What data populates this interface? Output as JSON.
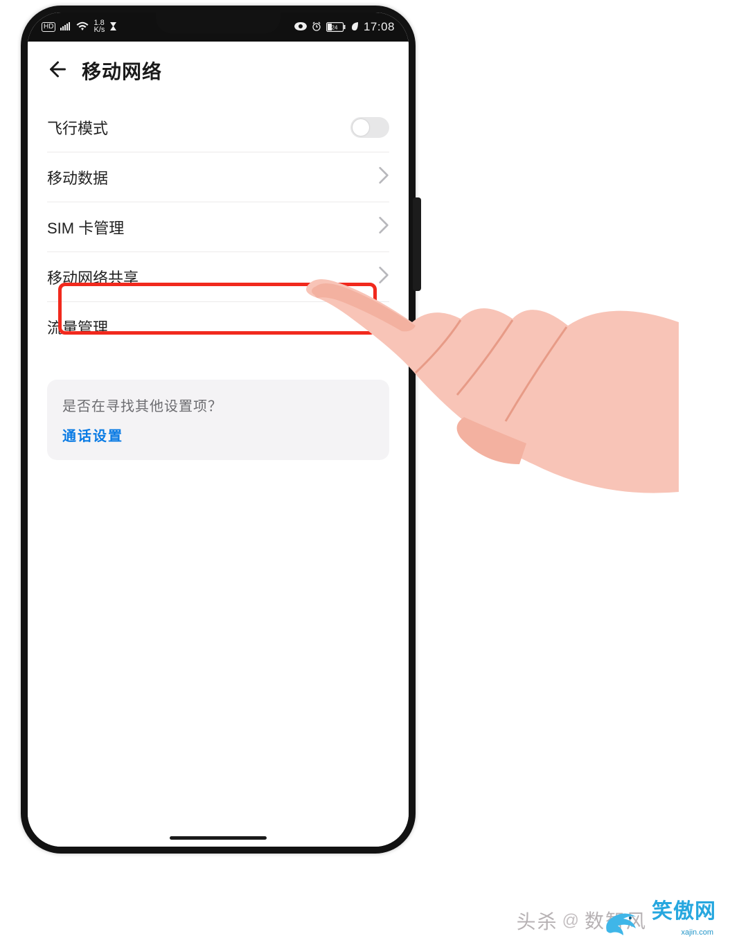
{
  "status": {
    "hd": "HD",
    "speed_top": "1.8",
    "speed_bottom": "K/s",
    "battery": "24",
    "time": "17:08"
  },
  "header": {
    "title": "移动网络"
  },
  "rows": {
    "airplane": "飞行模式",
    "mobile_data": "移动数据",
    "sim": "SIM 卡管理",
    "network_share": "移动网络共享",
    "traffic": "流量管理"
  },
  "help": {
    "question": "是否在寻找其他设置项？",
    "link": "通话设置"
  },
  "footer": {
    "text": "头杀",
    "brand1": "数智风",
    "brand2": "笑傲网",
    "url": "xajin.com"
  }
}
